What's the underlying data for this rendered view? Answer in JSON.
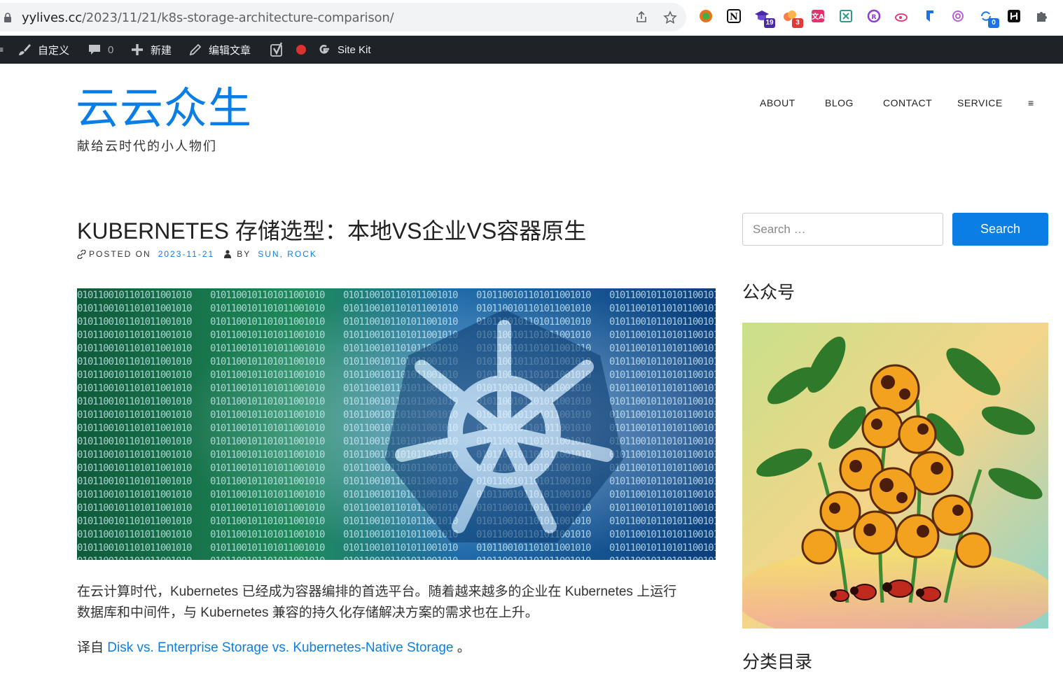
{
  "browser": {
    "url_host": "yylives.cc",
    "url_path": "/2023/11/21/k8s-storage-architecture-comparison/",
    "extensions": [
      {
        "name": "circle-extension-icon",
        "badge": ""
      },
      {
        "name": "notion-icon",
        "badge": ""
      },
      {
        "name": "graduation-cap-icon",
        "badge": "19"
      },
      {
        "name": "cloud-extension-icon",
        "badge": "3"
      },
      {
        "name": "translate-icon",
        "badge": ""
      },
      {
        "name": "grid-extension-icon",
        "badge": ""
      },
      {
        "name": "purple-extension-icon",
        "badge": ""
      },
      {
        "name": "weibo-icon",
        "badge": ""
      },
      {
        "name": "bookmark-extension-icon",
        "badge": ""
      },
      {
        "name": "openai-icon",
        "badge": ""
      },
      {
        "name": "sync-extension-icon",
        "badge": "0"
      },
      {
        "name": "h-extension-icon",
        "badge": ""
      },
      {
        "name": "puzzle-icon",
        "badge": ""
      }
    ]
  },
  "adminbar": {
    "customize": "自定义",
    "comments_count": "0",
    "new": "新建",
    "edit_post": "编辑文章",
    "site_kit": "Site Kit"
  },
  "site": {
    "title": "云云众生",
    "tagline": "献给云时代的小人物们"
  },
  "nav": {
    "items": [
      "ABOUT",
      "BLOG",
      "CONTACT",
      "SERVICE"
    ],
    "menu_icon": "≡"
  },
  "post": {
    "title": "KUBERNETES 存储选型：本地VS企业VS容器原生",
    "posted_on_label": "POSTED ON",
    "date": "2023-11-21",
    "by_label": "BY",
    "author": "SUN, ROCK",
    "para1_line1": "在云计算时代，Kubernetes 已经成为容器编排的首选平台。随着越来越多的企业在 Kubernetes 上运行",
    "para1_line2": "数据库和中间件，与 Kubernetes 兼容的持久化存储解决方案的需求也在上升。",
    "para2_prefix": "译自 ",
    "para2_link": "Disk vs. Enterprise Storage vs. Kubernetes-Native Storage",
    "para2_suffix": " 。"
  },
  "sidebar": {
    "search_placeholder": "Search …",
    "search_button": "Search",
    "widget1_title": "公众号",
    "widget2_title": "分类目录"
  },
  "colors": {
    "accent": "#0b7ee6",
    "adminbar": "#1d2327"
  }
}
